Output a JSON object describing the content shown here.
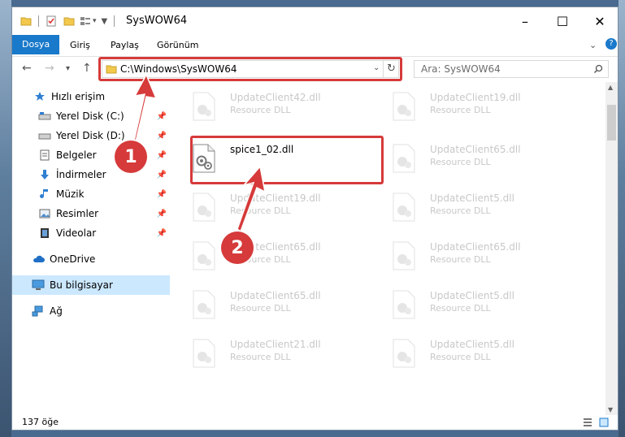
{
  "window": {
    "title": "SysWOW64",
    "minimize": "–",
    "maximize": "☐",
    "close": "✕"
  },
  "ribbon": {
    "tabs": [
      "Dosya",
      "Giriş",
      "Paylaş",
      "Görünüm"
    ],
    "expand": "⌄",
    "help": "?"
  },
  "address": {
    "path": "C:\\Windows\\SysWOW64",
    "search_placeholder": "Ara: SysWOW64"
  },
  "nav": {
    "quick_access": "Hızlı erişim",
    "items": [
      "Yerel Disk (C:)",
      "Yerel Disk (D:)",
      "Belgeler",
      "İndirmeler",
      "Müzik",
      "Resimler",
      "Videolar"
    ],
    "onedrive": "OneDrive",
    "this_pc": "Bu bilgisayar",
    "network": "Ağ"
  },
  "files": {
    "selected": {
      "name": "spice1_02.dll"
    },
    "faded_type": "Resource DLL",
    "left": [
      "UpdateClient42.dll",
      "UpdateClient19.dll",
      "UpdateClient65.dll",
      "UpdateClient65.dll",
      "UpdateClient21.dll"
    ],
    "right": [
      "UpdateClient19.dll",
      "UpdateClient65.dll",
      "UpdateClient5.dll",
      "UpdateClient65.dll",
      "UpdateClient5.dll",
      "UpdateClient5.dll"
    ]
  },
  "status": {
    "count": "137 öğe"
  },
  "annotations": {
    "step1": "1",
    "step2": "2"
  },
  "colors": {
    "accent": "#1979ca",
    "annotation": "#d63a3a",
    "selected_nav": "#cce8ff"
  }
}
